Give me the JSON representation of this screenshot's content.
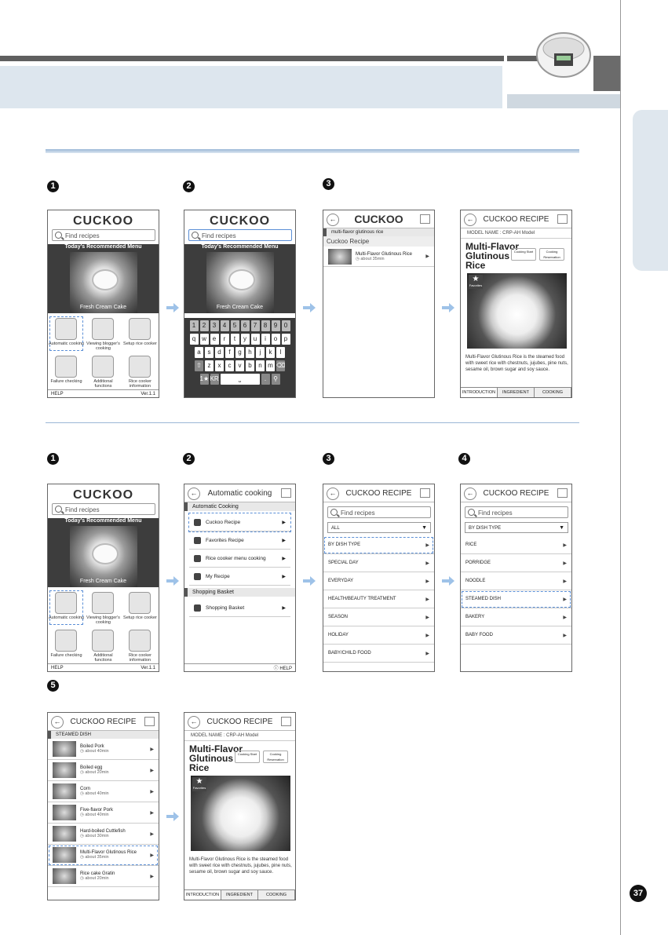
{
  "page_number": "37",
  "brand": "CUCKOO",
  "search_placeholder": "Find recipes",
  "home": {
    "today_menu": "Today's Recommended Menu",
    "dish": "Fresh Cream Cake",
    "grid": [
      "Automatic cooking",
      "Viewing blogger's cooking",
      "Setup rice cooker",
      "Failure checking",
      "Additional functions",
      "Rice cooker information"
    ],
    "bottom_help": "HELP",
    "version": "Ver.1.1"
  },
  "keyboard": {
    "numbers": [
      "1",
      "2",
      "3",
      "4",
      "5",
      "6",
      "7",
      "8",
      "9",
      "0"
    ],
    "row1": [
      "q",
      "w",
      "e",
      "r",
      "t",
      "y",
      "u",
      "i",
      "o",
      "p"
    ],
    "row2": [
      "a",
      "s",
      "d",
      "f",
      "g",
      "h",
      "j",
      "k",
      "l"
    ],
    "row3": [
      "z",
      "x",
      "c",
      "v",
      "b",
      "n",
      "m"
    ],
    "lang": "KR"
  },
  "search_result": {
    "query": "multi-flavor glutinous rice",
    "section": "Cuckoo Recipe",
    "item": "Multi-Flavor Glutinous Rice",
    "time": "about 35min"
  },
  "recipe": {
    "header": "CUCKOO RECIPE",
    "model": "MODEL NAME : CRP-AH Model",
    "title_l1": "Multi-Flavor",
    "title_l2": "Glutinous",
    "title_l3": "Rice",
    "btn_start": "Cooking Start",
    "btn_reserve": "Cooking Reservation",
    "badge": "Favorites",
    "description": "Multi-Flavor Glutinous Rice is the steamed food with sweet rice with chestnuts, jujubes, pine nuts, sesame oil, brown sugar and soy sauce.",
    "tabs": [
      "INTRODUCTION",
      "INGREDIENT",
      "COOKING ORDER"
    ]
  },
  "auto_cooking": {
    "header": "Automatic cooking",
    "section1": "Automatic Cooking",
    "items": [
      "Cuckoo Recipe",
      "Favorites Recipe",
      "Rice cooker menu cooking",
      "My Recipe"
    ],
    "section2": "Shopping Basket",
    "basket": "Shopping Basket",
    "help": "HELP"
  },
  "category_all": {
    "filter": "ALL",
    "items": [
      "BY DISH TYPE",
      "SPECIAL DAY",
      "EVERYDAY",
      "HEALTH/BEAUTY TREATMENT",
      "SEASON",
      "HOLIDAY",
      "BABY/CHILD FOOD"
    ]
  },
  "dish_type": {
    "filter": "BY DISH TYPE",
    "items": [
      "RICE",
      "PORRIDGE",
      "NOODLE",
      "STEAMED DISH",
      "BAKERY",
      "BABY FOOD"
    ]
  },
  "steamed": {
    "section": "STEAMED DISH",
    "items": [
      {
        "name": "Boiled Pork",
        "time": "about 40min"
      },
      {
        "name": "Boiled egg",
        "time": "about 20min"
      },
      {
        "name": "Corn",
        "time": "about 40min"
      },
      {
        "name": "Five-flavor Pork",
        "time": "about 40min"
      },
      {
        "name": "Hard-boiled Cuttlefish",
        "time": "about 30min"
      },
      {
        "name": "Multi-Flavor Glutinous Rice",
        "time": "about 35min"
      },
      {
        "name": "Rice cake Gratin",
        "time": "about 20min"
      }
    ]
  },
  "steps": [
    "1",
    "2",
    "3",
    "4",
    "5"
  ]
}
